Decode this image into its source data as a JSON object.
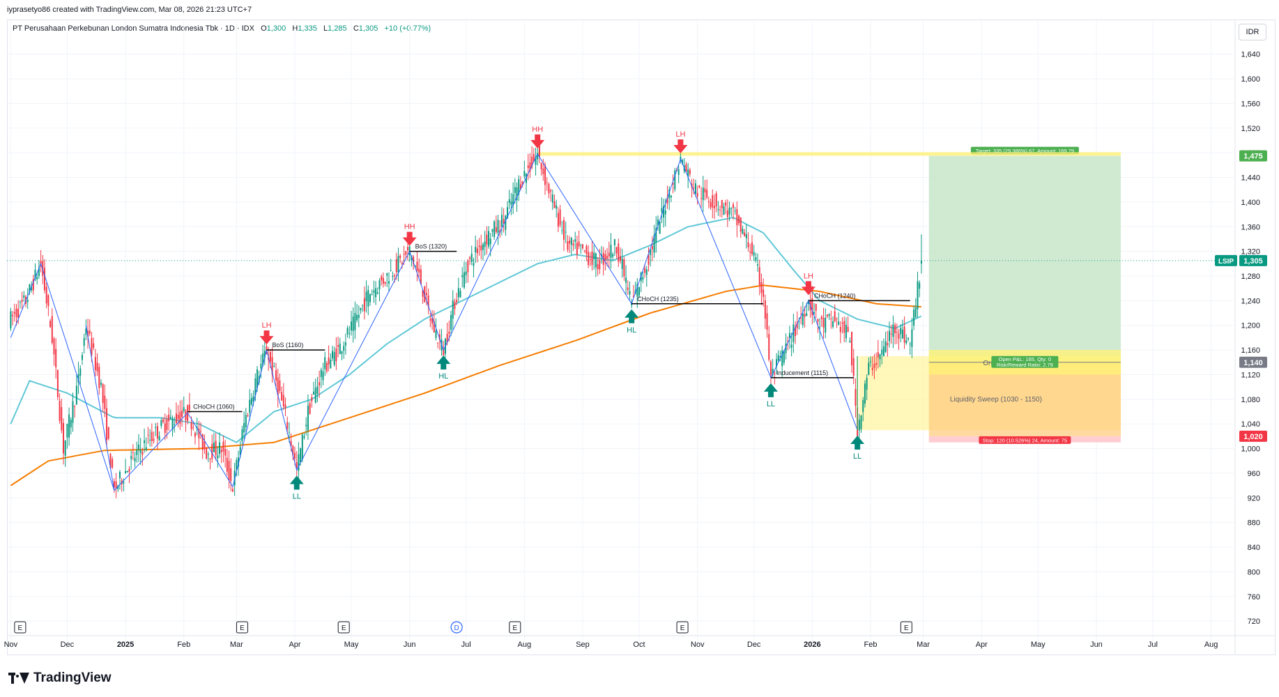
{
  "header": {
    "credit": "iyprasetyo86 created with TradingView.com, Mar 08, 2026 21:23 UTC+7"
  },
  "legend": {
    "title": "PT Perusahaan Perkebunan London Sumatra Indonesia Tbk · 1D · IDX",
    "o_label": "O",
    "o_value": "1,300",
    "h_label": "H",
    "h_value": "1,335",
    "l_label": "L",
    "l_value": "1,285",
    "c_label": "C",
    "c_value": "1,305",
    "change": "+10 (+0.77%)"
  },
  "currency": "IDR",
  "branding": {
    "logo_text": "TradingView"
  },
  "colors": {
    "up": "#089981",
    "down": "#f23645",
    "ma_fast": "#5fc8d6",
    "ma_slow": "#f57c00",
    "zigzag": "#2962ff",
    "level_line": "#fff176",
    "target_zone": "#c8e6c9",
    "stop_zone": "#ffcdd2",
    "order_block": "#fff59d",
    "liquidity_zone": "#ffcc80"
  },
  "chart_data": {
    "type": "candlestick",
    "title": "PT Perusahaan Perkebunan London Sumatra Indonesia Tbk · 1D · IDX",
    "ylim": [
      710,
      1660
    ],
    "y_ticks": [
      720,
      760,
      800,
      840,
      880,
      920,
      960,
      1000,
      1040,
      1080,
      1120,
      1160,
      1200,
      1240,
      1280,
      1320,
      1360,
      1400,
      1440,
      1480,
      1520,
      1560,
      1600,
      1640
    ],
    "y_tick_labels": [
      "720",
      "760",
      "800",
      "840",
      "880",
      "920",
      "960",
      "1,000",
      "1,040",
      "1,080",
      "1,120",
      "1,160",
      "1,200",
      "1,240",
      "1,280",
      "1,320",
      "1,360",
      "1,400",
      "1,440",
      "1,480",
      "1,520",
      "1,560",
      "1,600",
      "1,640"
    ],
    "x_labels": [
      {
        "t": 0,
        "label": "Nov"
      },
      {
        "t": 30,
        "label": "Dec"
      },
      {
        "t": 61,
        "label": "2025",
        "bold": true
      },
      {
        "t": 92,
        "label": "Feb"
      },
      {
        "t": 120,
        "label": "Mar"
      },
      {
        "t": 151,
        "label": "Apr"
      },
      {
        "t": 181,
        "label": "May"
      },
      {
        "t": 212,
        "label": "Jun"
      },
      {
        "t": 242,
        "label": "Jul"
      },
      {
        "t": 273,
        "label": "Aug"
      },
      {
        "t": 304,
        "label": "Sep"
      },
      {
        "t": 334,
        "label": "Oct"
      },
      {
        "t": 365,
        "label": "Nov"
      },
      {
        "t": 395,
        "label": "Dec"
      },
      {
        "t": 426,
        "label": "2026",
        "bold": true
      },
      {
        "t": 457,
        "label": "Feb"
      },
      {
        "t": 485,
        "label": "Mar"
      },
      {
        "t": 516,
        "label": "Apr"
      },
      {
        "t": 546,
        "label": "May"
      },
      {
        "t": 577,
        "label": "Jun"
      },
      {
        "t": 607,
        "label": "Jul"
      },
      {
        "t": 638,
        "label": "Aug"
      }
    ],
    "event_markers": [
      {
        "t": 5,
        "label": "E"
      },
      {
        "t": 123,
        "label": "E"
      },
      {
        "t": 177,
        "label": "E"
      },
      {
        "t": 237,
        "label": "D"
      },
      {
        "t": 268,
        "label": "E"
      },
      {
        "t": 357,
        "label": "E"
      },
      {
        "t": 476,
        "label": "E"
      }
    ],
    "price_path": [
      {
        "t": 0,
        "p": 1210
      },
      {
        "t": 8,
        "p": 1240
      },
      {
        "t": 16,
        "p": 1300
      },
      {
        "t": 22,
        "p": 1180
      },
      {
        "t": 28,
        "p": 1000
      },
      {
        "t": 36,
        "p": 1110
      },
      {
        "t": 40,
        "p": 1200
      },
      {
        "t": 48,
        "p": 1100
      },
      {
        "t": 55,
        "p": 932
      },
      {
        "t": 64,
        "p": 980
      },
      {
        "t": 72,
        "p": 1010
      },
      {
        "t": 82,
        "p": 1040
      },
      {
        "t": 94,
        "p": 1058
      },
      {
        "t": 104,
        "p": 995
      },
      {
        "t": 112,
        "p": 1000
      },
      {
        "t": 118,
        "p": 938
      },
      {
        "t": 124,
        "p": 1040
      },
      {
        "t": 130,
        "p": 1110
      },
      {
        "t": 136,
        "p": 1160
      },
      {
        "t": 142,
        "p": 1100
      },
      {
        "t": 147,
        "p": 1040
      },
      {
        "t": 152,
        "p": 965
      },
      {
        "t": 158,
        "p": 1060
      },
      {
        "t": 166,
        "p": 1130
      },
      {
        "t": 174,
        "p": 1160
      },
      {
        "t": 182,
        "p": 1200
      },
      {
        "t": 190,
        "p": 1250
      },
      {
        "t": 200,
        "p": 1280
      },
      {
        "t": 212,
        "p": 1320
      },
      {
        "t": 218,
        "p": 1270
      },
      {
        "t": 224,
        "p": 1200
      },
      {
        "t": 230,
        "p": 1160
      },
      {
        "t": 236,
        "p": 1240
      },
      {
        "t": 243,
        "p": 1300
      },
      {
        "t": 252,
        "p": 1340
      },
      {
        "t": 262,
        "p": 1370
      },
      {
        "t": 270,
        "p": 1430
      },
      {
        "t": 280,
        "p": 1478
      },
      {
        "t": 288,
        "p": 1400
      },
      {
        "t": 296,
        "p": 1330
      },
      {
        "t": 304,
        "p": 1320
      },
      {
        "t": 312,
        "p": 1300
      },
      {
        "t": 322,
        "p": 1330
      },
      {
        "t": 330,
        "p": 1235
      },
      {
        "t": 338,
        "p": 1300
      },
      {
        "t": 346,
        "p": 1380
      },
      {
        "t": 356,
        "p": 1470
      },
      {
        "t": 364,
        "p": 1420
      },
      {
        "t": 374,
        "p": 1400
      },
      {
        "t": 384,
        "p": 1380
      },
      {
        "t": 394,
        "p": 1320
      },
      {
        "t": 400,
        "p": 1250
      },
      {
        "t": 404,
        "p": 1115
      },
      {
        "t": 410,
        "p": 1150
      },
      {
        "t": 418,
        "p": 1200
      },
      {
        "t": 424,
        "p": 1240
      },
      {
        "t": 430,
        "p": 1200
      },
      {
        "t": 438,
        "p": 1210
      },
      {
        "t": 446,
        "p": 1180
      },
      {
        "t": 450,
        "p": 1030
      },
      {
        "t": 456,
        "p": 1130
      },
      {
        "t": 462,
        "p": 1150
      },
      {
        "t": 470,
        "p": 1200
      },
      {
        "t": 478,
        "p": 1170
      },
      {
        "t": 484,
        "p": 1305
      }
    ],
    "zigzag": [
      {
        "t": 0,
        "p": 1180
      },
      {
        "t": 16,
        "p": 1300
      },
      {
        "t": 55,
        "p": 932
      },
      {
        "t": 40,
        "p": 1200
      },
      {
        "t": 55,
        "p": 932
      },
      {
        "t": 94,
        "p": 1058
      },
      {
        "t": 118,
        "p": 938
      },
      {
        "t": 136,
        "p": 1160
      },
      {
        "t": 152,
        "p": 965
      },
      {
        "t": 212,
        "p": 1320
      },
      {
        "t": 230,
        "p": 1160
      },
      {
        "t": 280,
        "p": 1478
      },
      {
        "t": 330,
        "p": 1235
      },
      {
        "t": 356,
        "p": 1470
      },
      {
        "t": 404,
        "p": 1115
      },
      {
        "t": 424,
        "p": 1240
      },
      {
        "t": 450,
        "p": 1030
      }
    ],
    "ma_fast": [
      {
        "t": 0,
        "p": 1040
      },
      {
        "t": 10,
        "p": 1110
      },
      {
        "t": 30,
        "p": 1090
      },
      {
        "t": 55,
        "p": 1050
      },
      {
        "t": 80,
        "p": 1050
      },
      {
        "t": 100,
        "p": 1040
      },
      {
        "t": 120,
        "p": 1010
      },
      {
        "t": 140,
        "p": 1060
      },
      {
        "t": 160,
        "p": 1080
      },
      {
        "t": 180,
        "p": 1120
      },
      {
        "t": 200,
        "p": 1170
      },
      {
        "t": 220,
        "p": 1210
      },
      {
        "t": 240,
        "p": 1240
      },
      {
        "t": 260,
        "p": 1270
      },
      {
        "t": 280,
        "p": 1300
      },
      {
        "t": 300,
        "p": 1315
      },
      {
        "t": 320,
        "p": 1305
      },
      {
        "t": 340,
        "p": 1330
      },
      {
        "t": 360,
        "p": 1360
      },
      {
        "t": 384,
        "p": 1375
      },
      {
        "t": 400,
        "p": 1350
      },
      {
        "t": 416,
        "p": 1290
      },
      {
        "t": 430,
        "p": 1240
      },
      {
        "t": 450,
        "p": 1210
      },
      {
        "t": 470,
        "p": 1195
      },
      {
        "t": 484,
        "p": 1215
      }
    ],
    "ma_slow": [
      {
        "t": 0,
        "p": 940
      },
      {
        "t": 20,
        "p": 980
      },
      {
        "t": 50,
        "p": 997
      },
      {
        "t": 100,
        "p": 1000
      },
      {
        "t": 140,
        "p": 1010
      },
      {
        "t": 180,
        "p": 1050
      },
      {
        "t": 220,
        "p": 1090
      },
      {
        "t": 260,
        "p": 1135
      },
      {
        "t": 300,
        "p": 1175
      },
      {
        "t": 340,
        "p": 1220
      },
      {
        "t": 380,
        "p": 1255
      },
      {
        "t": 400,
        "p": 1265
      },
      {
        "t": 430,
        "p": 1255
      },
      {
        "t": 460,
        "p": 1235
      },
      {
        "t": 484,
        "p": 1230
      }
    ],
    "pivots": [
      {
        "t": 136,
        "p": 1160,
        "label": "LH",
        "dir": "down"
      },
      {
        "t": 152,
        "p": 965,
        "label": "LL",
        "dir": "up"
      },
      {
        "t": 212,
        "p": 1320,
        "label": "HH",
        "dir": "down"
      },
      {
        "t": 230,
        "p": 1160,
        "label": "HL",
        "dir": "up"
      },
      {
        "t": 280,
        "p": 1478,
        "label": "HH",
        "dir": "down"
      },
      {
        "t": 330,
        "p": 1235,
        "label": "HL",
        "dir": "up"
      },
      {
        "t": 356,
        "p": 1470,
        "label": "LH",
        "dir": "down"
      },
      {
        "t": 404,
        "p": 1115,
        "label": "LL",
        "dir": "up"
      },
      {
        "t": 424,
        "p": 1240,
        "label": "LH",
        "dir": "down"
      },
      {
        "t": 450,
        "p": 1030,
        "label": "LL",
        "dir": "up"
      }
    ],
    "structure_lines": [
      {
        "t1": 94,
        "t2": 123,
        "p": 1060,
        "label": "CHoCH (1060)"
      },
      {
        "t1": 136,
        "t2": 167,
        "p": 1160,
        "label": "BoS (1160)"
      },
      {
        "t1": 212,
        "t2": 237,
        "p": 1320,
        "label": "BoS (1320)"
      },
      {
        "t1": 330,
        "t2": 400,
        "p": 1235,
        "label": "CHoCH (1235)"
      },
      {
        "t1": 424,
        "t2": 478,
        "p": 1240,
        "label": "CHoCH (1240)"
      },
      {
        "t1": 404,
        "t2": 448,
        "p": 1115,
        "label": "Inducement (1115)"
      }
    ],
    "resistance_line": {
      "t1": 280,
      "t2": 590,
      "p": 1478
    },
    "zones": {
      "liquidity_sweep": {
        "t1": 451,
        "t2": 590,
        "p1": 1030,
        "p2": 1150,
        "label": "Liquidity Sweep (1030 - 1150)"
      },
      "order_block": {
        "t1": 488,
        "t2": 590,
        "p1": 1120,
        "p2": 1160,
        "label": "Order Block"
      }
    },
    "position": {
      "t1": 488,
      "t2": 590,
      "entry": 1140,
      "target": 1475,
      "stop": 1020,
      "target_label": "Target: 335 (29.386%) 67, Amount: 169.79",
      "stop_label": "Stop: 120 (10.526%) 24, Amount: 75",
      "open_pnl": "Open P&L: 165, Qty: 0",
      "risk_reward": "Risk/Reward Ratio: 2.79"
    },
    "price_tags": [
      {
        "p": 1475,
        "label": "1,475",
        "color": "#4caf50"
      },
      {
        "p": 1305,
        "label": "1,305",
        "color": "#089981",
        "symbol": "LSIP"
      },
      {
        "p": 1140,
        "label": "1,140",
        "color": "#787b86"
      },
      {
        "p": 1020,
        "label": "1,020",
        "color": "#f23645"
      }
    ],
    "last_price": 1305
  }
}
